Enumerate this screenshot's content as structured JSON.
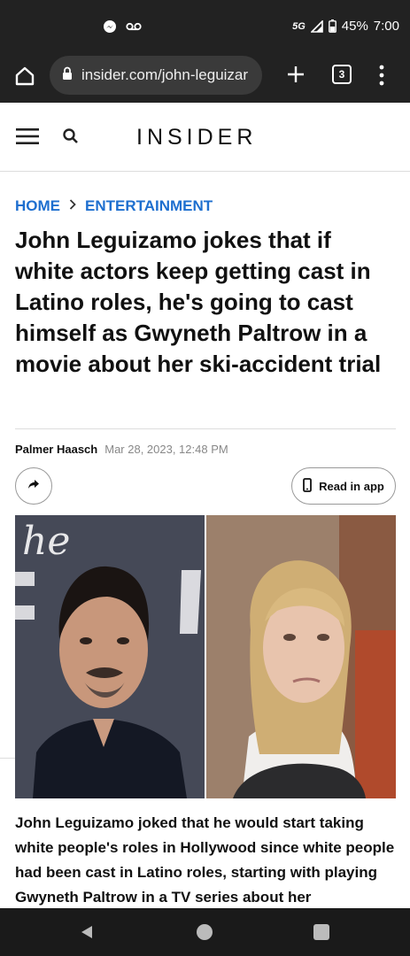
{
  "status_bar": {
    "left_icons": [
      "messenger-icon",
      "voicemail-icon"
    ],
    "network": "5G",
    "battery": "45%",
    "time": "7:00"
  },
  "browser": {
    "url": "insider.com/john-leguizar",
    "tab_count": "3"
  },
  "site": {
    "logo": "INSIDER"
  },
  "article": {
    "breadcrumb": [
      "HOME",
      "ENTERTAINMENT"
    ],
    "headline": "John Leguizamo jokes that if white actors keep getting cast in Latino roles, he's going to cast himself as Gwyneth Paltrow in a movie about her ski-accident trial",
    "author": "Palmer Haasch",
    "date": "Mar 28, 2023, 12:48 PM",
    "read_in_app": "Read in app",
    "caption": "John Leguizamo joked that he would start taking white people's roles in Hollywood since white people had been cast in Latino roles, starting with playing Gwyneth Paltrow in a TV series about her",
    "photo_backdrop_text": "he"
  },
  "colors": {
    "link_blue": "#1e6fcf",
    "browser_bg": "#222222"
  }
}
